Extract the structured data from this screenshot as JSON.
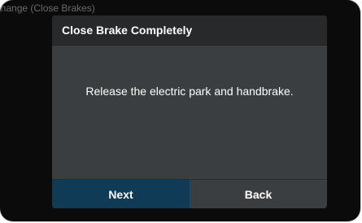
{
  "background_title": "Change (Close Brakes)",
  "dialog": {
    "title": "Close Brake Completely",
    "message": "Release the electric park and handbrake.",
    "buttons": {
      "next": "Next",
      "back": "Back"
    }
  },
  "colors": {
    "screen_bg": "#0b0b0b",
    "dialog_bg": "#3b3e40",
    "header_bg": "#27292b",
    "primary_button_bg": "#0f3b57"
  }
}
